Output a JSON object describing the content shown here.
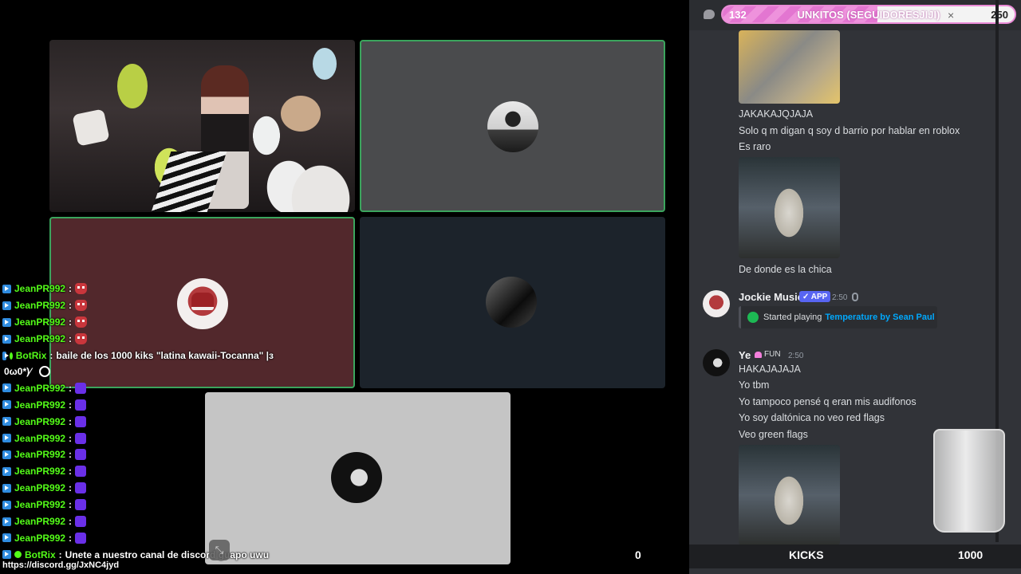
{
  "chat_overlay": {
    "lines": [
      {
        "user": "JeanPR992",
        "emote": "red"
      },
      {
        "user": "JeanPR992",
        "emote": "red"
      },
      {
        "user": "JeanPR992",
        "emote": "red"
      },
      {
        "user": "JeanPR992",
        "emote": "red"
      }
    ],
    "bot_message_1": {
      "user": "BotRix",
      "text": "baile de los 1000 kiks \"latina kawaii-Tocanna\" |з",
      "continuation": "0ω0*)⁄"
    },
    "lines2": [
      {
        "user": "JeanPR992",
        "emote": "purple"
      },
      {
        "user": "JeanPR992",
        "emote": "purple"
      },
      {
        "user": "JeanPR992",
        "emote": "purple"
      },
      {
        "user": "JeanPR992",
        "emote": "purple"
      },
      {
        "user": "JeanPR992",
        "emote": "purple"
      },
      {
        "user": "JeanPR992",
        "emote": "purple"
      },
      {
        "user": "JeanPR992",
        "emote": "purple"
      },
      {
        "user": "JeanPR992",
        "emote": "purple"
      },
      {
        "user": "JeanPR992",
        "emote": "purple"
      },
      {
        "user": "JeanPR992",
        "emote": "purple"
      }
    ],
    "bot_message_2": {
      "user": "BotRix",
      "text": "Unete a nuestro canal de discord guapo uwu",
      "link": "https://discord.gg/JxNC4jyd"
    },
    "separator": ":"
  },
  "overlay_counter": "0",
  "goal": {
    "current": "132",
    "title": "UNKITOS (SEGUIDORESJIJI)",
    "max": "250",
    "close": "×",
    "progress": 0.53
  },
  "discord": {
    "messages_top": [
      "JAKAKAJQJAJA",
      "Solo q m digan q soy d barrio por hablar en roblox",
      "Es raro"
    ],
    "after_wolf": "De donde es la chica",
    "jockie": {
      "name": "Jockie Music",
      "tag": "✓ APP",
      "time": "2:50",
      "embed_prefix": "Started playing",
      "song": "Temperature by Sean Paul"
    },
    "ye": {
      "name": "Ye",
      "tag": "FUN",
      "time": "2:50",
      "lines": [
        "HAKAJAJAJA",
        "Yo tbm",
        "Yo tampoco pensé q eran mis audifonos",
        "Yo soy daltónica no veo red flags",
        "Veo green flags"
      ]
    }
  },
  "kicks": {
    "label": "KICKS",
    "goal": "1000"
  },
  "colors": {
    "kick_green": "#53fc18",
    "discord_bg": "#313338",
    "speaking_border": "#3ba55d",
    "goal_pink": "#e376d1"
  }
}
